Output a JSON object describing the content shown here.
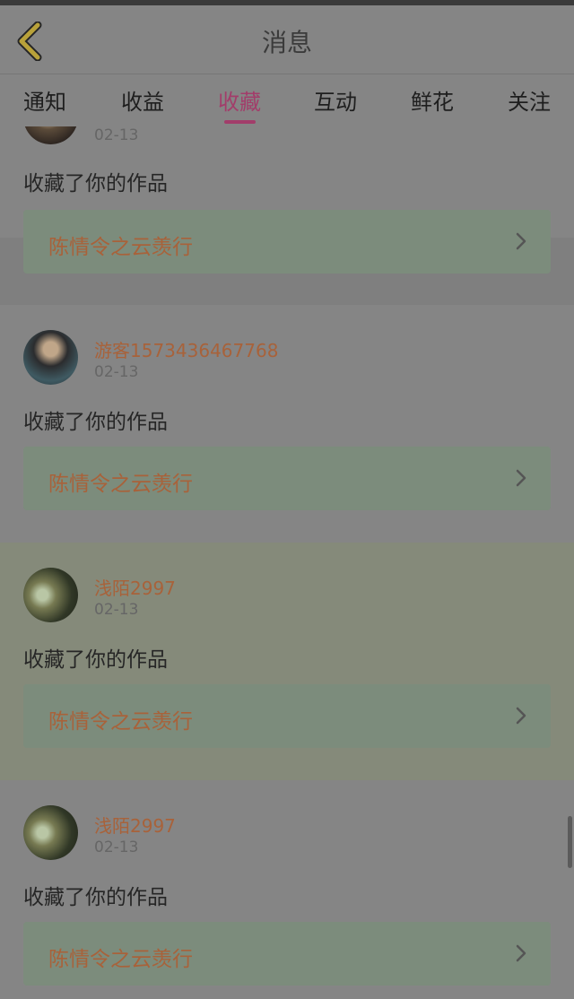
{
  "header": {
    "title": "消息",
    "back_icon": "chevron-left-icon",
    "back_color": "#b9a23a"
  },
  "tabs": [
    {
      "label": "通知"
    },
    {
      "label": "收益"
    },
    {
      "label": "收藏",
      "active": true
    },
    {
      "label": "互动"
    },
    {
      "label": "鲜花"
    },
    {
      "label": "关注"
    }
  ],
  "colors": {
    "accent": "#a23d6a",
    "name": "#a8623a",
    "card_bg": "#7c8c7c"
  },
  "items": [
    {
      "date": "02-13",
      "message": "收藏了你的作品",
      "work_title": "陈情令之云羡行"
    },
    {
      "name": "游客1573436467768",
      "date": "02-13",
      "message": "收藏了你的作品",
      "work_title": "陈情令之云羡行"
    },
    {
      "name": "浅陌2997",
      "date": "02-13",
      "message": "收藏了你的作品",
      "work_title": "陈情令之云羡行"
    },
    {
      "name": "浅陌2997",
      "date": "02-13",
      "message": "收藏了你的作品",
      "work_title": "陈情令之云羡行"
    }
  ]
}
